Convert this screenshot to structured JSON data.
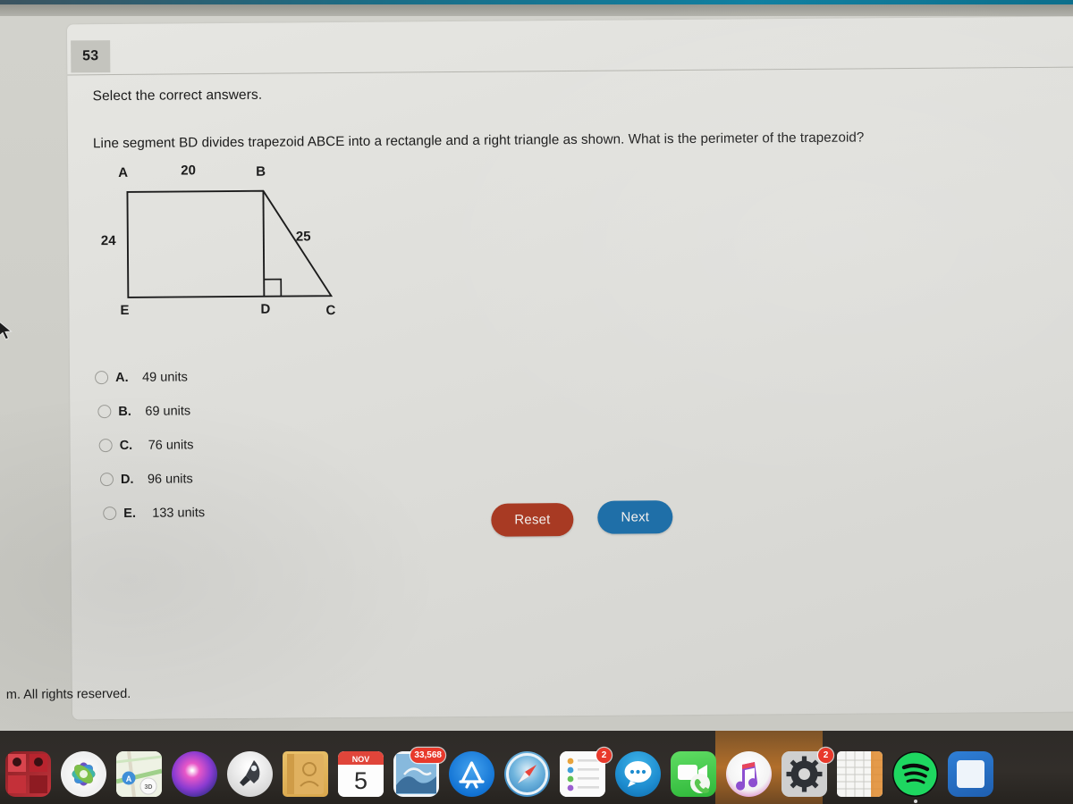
{
  "question": {
    "number": "53",
    "instruction": "Select the correct answers.",
    "prompt": "Line segment BD divides trapezoid ABCE into a rectangle and a right triangle as shown. What is the perimeter of the trapezoid?"
  },
  "figure": {
    "shape_name": "trapezoid-abce",
    "vertex_labels": {
      "a": "A",
      "b": "B",
      "c": "C",
      "d": "D",
      "e": "E"
    },
    "measures": {
      "top": "20",
      "left": "24",
      "hypotenuse": "25"
    },
    "has_right_angle_mark": true
  },
  "options": [
    {
      "letter": "A.",
      "text": "49 units",
      "selected": false
    },
    {
      "letter": "B.",
      "text": "69 units",
      "selected": false
    },
    {
      "letter": "C.",
      "text": "76 units",
      "selected": false
    },
    {
      "letter": "D.",
      "text": "96 units",
      "selected": false
    },
    {
      "letter": "E.",
      "text": "133 units",
      "selected": false
    }
  ],
  "buttons": {
    "reset_label": "Reset",
    "next_label": "Next",
    "reset_color": "#a83a23",
    "next_color": "#1f6fa8"
  },
  "footer": {
    "copyright": "m. All rights reserved."
  },
  "dock": {
    "items": [
      {
        "name": "photo-booth",
        "badge": ""
      },
      {
        "name": "photos",
        "badge": ""
      },
      {
        "name": "maps",
        "badge": ""
      },
      {
        "name": "siri",
        "badge": ""
      },
      {
        "name": "launchpad",
        "badge": ""
      },
      {
        "name": "contacts",
        "badge": ""
      },
      {
        "name": "calendar",
        "badge": "",
        "month": "NOV",
        "day": "5"
      },
      {
        "name": "mail",
        "badge": "33,568"
      },
      {
        "name": "app-store",
        "badge": ""
      },
      {
        "name": "safari",
        "badge": ""
      },
      {
        "name": "reminders",
        "badge": "2"
      },
      {
        "name": "messages",
        "badge": ""
      },
      {
        "name": "facetime",
        "badge": ""
      },
      {
        "name": "itunes",
        "badge": ""
      },
      {
        "name": "system-preferences",
        "badge": "2"
      },
      {
        "name": "numbers",
        "badge": ""
      },
      {
        "name": "spotify",
        "badge": ""
      },
      {
        "name": "blue-app",
        "badge": ""
      }
    ]
  }
}
